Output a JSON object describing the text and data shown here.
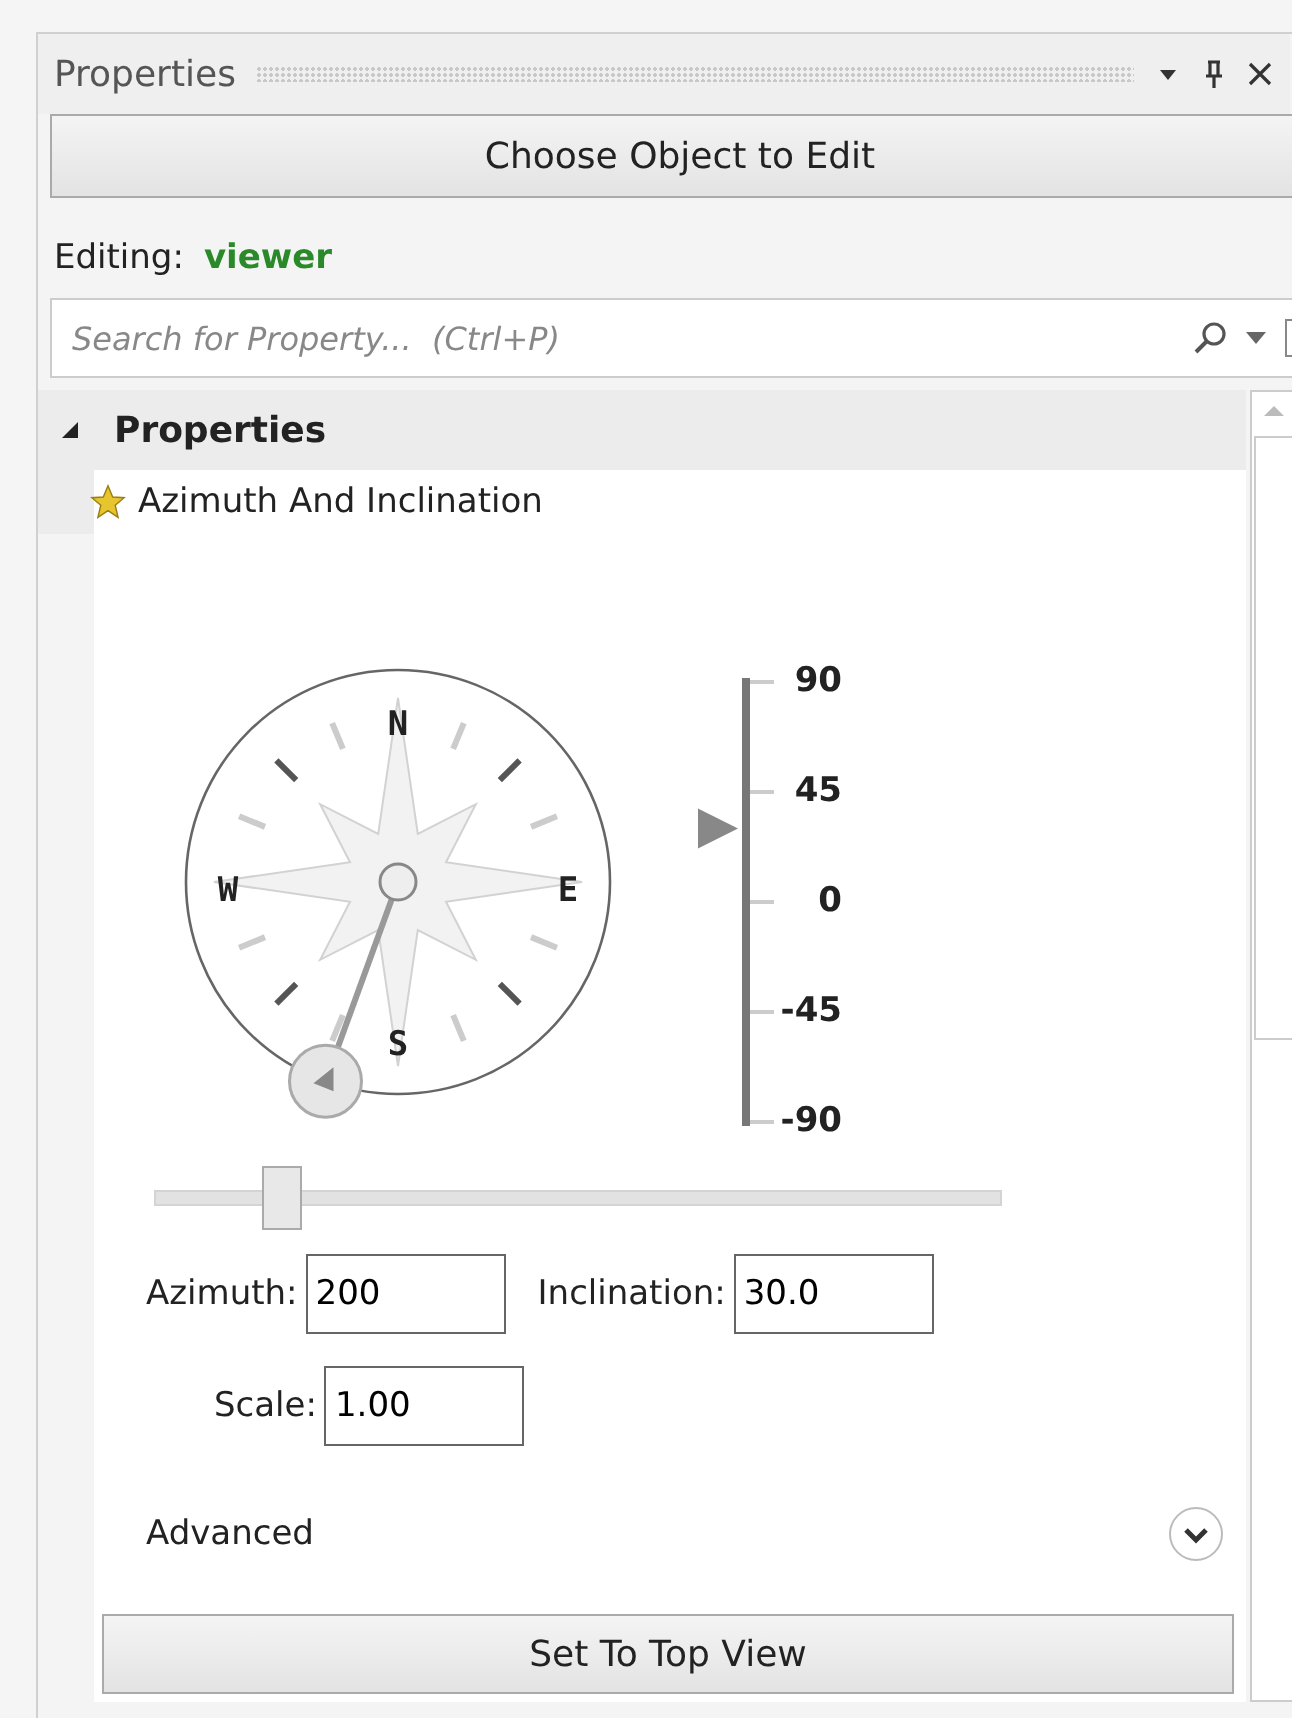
{
  "panel": {
    "title": "Properties"
  },
  "choose_button": "Choose Object to Edit",
  "editing": {
    "label": "Editing:",
    "value": "viewer"
  },
  "search": {
    "placeholder": "Search for Property...  (Ctrl+P)"
  },
  "category": {
    "label": "Properties",
    "expanded": true
  },
  "property": {
    "label": "Azimuth And Inclination"
  },
  "compass": {
    "labels": [
      "N",
      "E",
      "S",
      "W"
    ]
  },
  "inclination_scale": {
    "labels": [
      "90",
      "45",
      "0",
      "-45",
      "-90"
    ],
    "level": 0.667
  },
  "slider": {
    "level": 0.1
  },
  "fields": [
    {
      "label": "Azimuth:",
      "value": "200"
    },
    {
      "label": "Inclination:",
      "value": "30.0"
    },
    {
      "label": "Scale:",
      "value": "1.00"
    }
  ],
  "advanced": {
    "label": "Advanced",
    "expanded": false
  },
  "bottom_button": "Set To Top View"
}
